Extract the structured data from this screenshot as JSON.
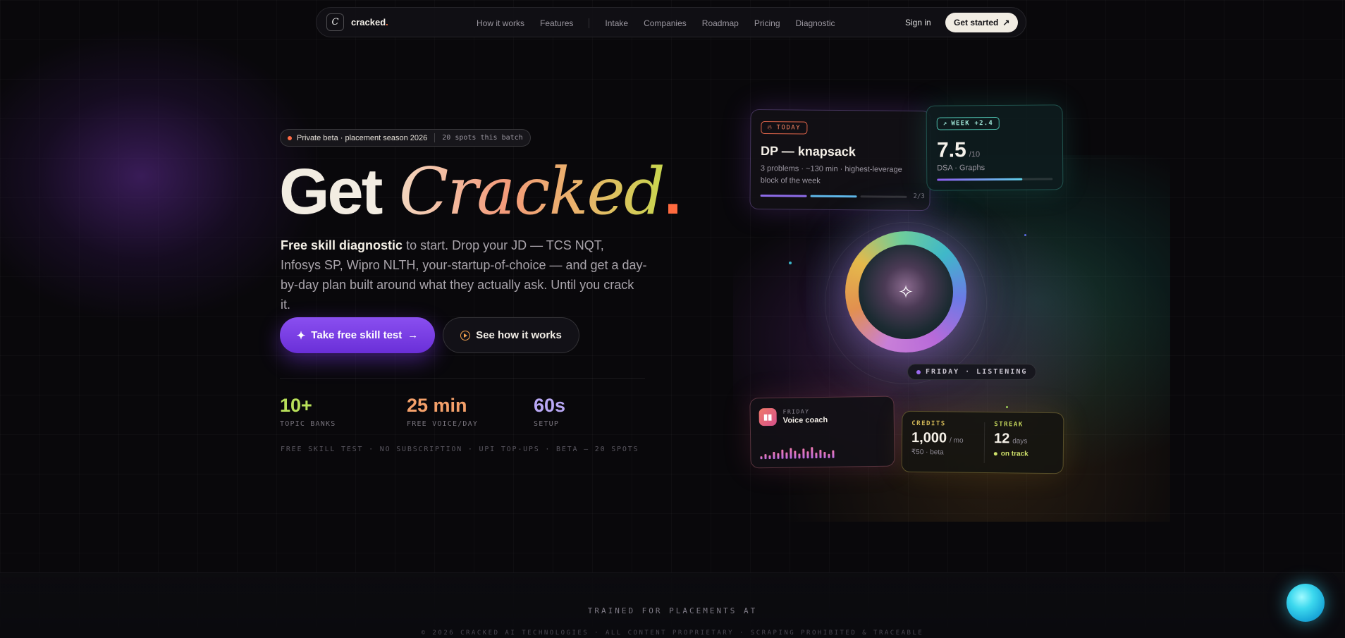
{
  "nav": {
    "logo_letter": "C",
    "logo_text": "cracked",
    "logo_dot": ".",
    "links_group1": [
      "How it works",
      "Features"
    ],
    "links_group2": [
      "Intake",
      "Companies",
      "Roadmap",
      "Pricing",
      "Diagnostic"
    ],
    "sign_in": "Sign in",
    "get_started": "Get started",
    "get_started_icon": "↗"
  },
  "hero": {
    "badge_main": "Private beta · placement season 2026",
    "badge_spots": "20 spots this batch",
    "headline_get": "Get",
    "headline_cracked": "Cracked",
    "headline_dot": ".",
    "sub_bold": "Free skill diagnostic",
    "sub_rest": " to start. Drop your JD — TCS NQT, Infosys SP, Wipro NLTH, your-startup-of-choice — and get a day-by-day plan built around what they actually ask. Until you crack it.",
    "btn_primary": "Take free skill test",
    "btn_primary_icon": "✦",
    "btn_primary_arrow": "→",
    "btn_secondary": "See how it works",
    "stats": [
      {
        "value": "10+",
        "label": "TOPIC BANKS",
        "color": "#b8e05a"
      },
      {
        "value": "25 min",
        "label": "FREE VOICE/DAY",
        "color": "#f4a06a"
      },
      {
        "value": "60s",
        "label": "SETUP",
        "color": "#b9a8f5"
      }
    ],
    "fineprint": "FREE SKILL TEST · NO SUBSCRIPTION · UPI TOP-UPS · BETA — 20 SPOTS"
  },
  "cards": {
    "today": {
      "tag": "TODAY",
      "title": "DP — knapsack",
      "subtitle": "3 problems · ~130 min · highest-leverage block of the week",
      "progress": "2/3"
    },
    "week": {
      "tag": "WEEK +2.4",
      "score": "7.5",
      "score_max": "/10",
      "subject": "DSA · Graphs",
      "fill": 0.74
    },
    "listening": "FRIDAY · LISTENING",
    "voice": {
      "kicker": "FRIDAY",
      "title": "Voice coach"
    },
    "credits": {
      "kicker": "CREDITS",
      "value": "1,000",
      "unit": "/ mo",
      "sub": "₹50 · beta"
    },
    "streak": {
      "kicker": "STREAK",
      "value": "12",
      "unit": "days",
      "status": "on track"
    }
  },
  "footer": {
    "trained": "TRAINED FOR PLACEMENTS AT",
    "copyright": "© 2026 CRACKED AI TECHNOLOGIES  ·  ALL CONTENT PROPRIETARY  ·  SCRAPING PROHIBITED & TRACEABLE"
  },
  "colors": {
    "background": "#09080b",
    "accent_purple": "#7c3aed",
    "accent_orange": "#ff6a3f",
    "accent_teal": "#4bb9a8",
    "accent_lime": "#cfe16a"
  }
}
